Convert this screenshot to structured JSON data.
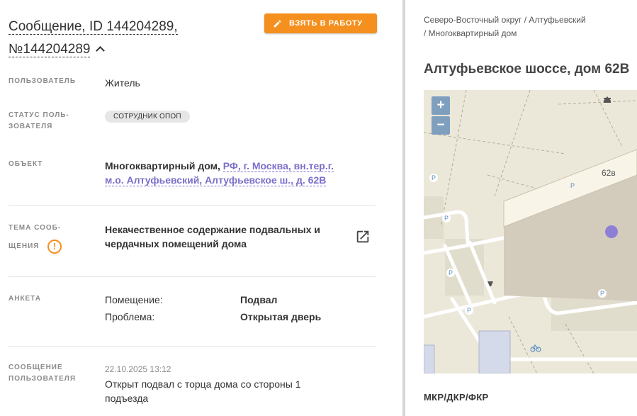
{
  "header": {
    "title": "Сообщение, ID 144204289, №144204289",
    "take_button_label": "ВЗЯТЬ В РАБОТУ"
  },
  "fields": {
    "user_label": "ПОЛЬЗОВАТЕЛЬ",
    "user_value": "Житель",
    "status_label_1": "СТАТУС ПОЛЬ-",
    "status_label_2": "ЗОВАТЕЛЯ",
    "status_value": "СОТРУДНИК ОПОП",
    "object_label": "ОБЪЕКТ",
    "object_type": "Многоквартирный дом,",
    "object_address": "РФ, г. Москва, вн.тер.г. м.о. Алтуфьевский, Алтуфьевское ш., д. 62В",
    "topic_label_1": "ТЕМА СООБ-",
    "topic_label_2": "ЩЕНИЯ",
    "topic_value": "Некачественное содержание подвальных и чердачных помещений дома",
    "survey_label": "АНКЕТА",
    "survey": [
      {
        "key": "Помещение:",
        "value": "Подвал"
      },
      {
        "key": "Проблема:",
        "value": "Открытая дверь"
      }
    ],
    "message_label_1": "СООБЩЕНИЕ",
    "message_label_2": "ПОЛЬЗОВАТЕЛЯ",
    "message_date": "22.10.2025 13:12",
    "message_text": "Открыт подвал с торца дома со стороны 1 подъезда"
  },
  "right": {
    "breadcrumb_1": "Северо-Восточный округ / Алтуфьевский",
    "breadcrumb_2": "/ Многоквартирный дом",
    "address": "Алтуфьевское шоссе, дом 62В",
    "map_building_number": "62в",
    "zoom_in": "+",
    "zoom_out": "−",
    "section_label": "МКР/ДКР/ФКР"
  },
  "colors": {
    "accent": "#f5901e",
    "link": "#7a6fc9",
    "marker": "#8e7fd6"
  }
}
